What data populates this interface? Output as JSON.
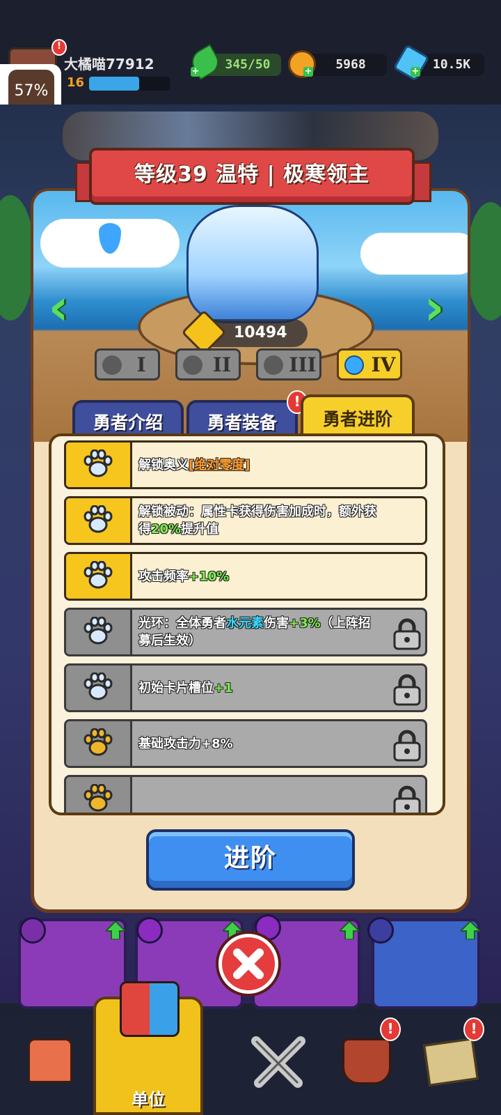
{
  "hud": {
    "player_name": "大橘喵77912",
    "level": "16",
    "xp_fraction": 0.62,
    "stamina": "345/50",
    "coins": "5968",
    "gems": "10.5K"
  },
  "overlay": {
    "percent": "57%"
  },
  "hero": {
    "title": "等级39 温特 | 极寒领主",
    "power": "10494",
    "ranks": [
      "I",
      "II",
      "III",
      "IV"
    ],
    "active_rank": "IV"
  },
  "tabs": [
    {
      "label": "勇者介绍",
      "active": false
    },
    {
      "label": "勇者装备",
      "active": false,
      "badge": "!"
    },
    {
      "label": "勇者进阶",
      "active": true
    }
  ],
  "advancement": [
    {
      "state": "unlocked",
      "paw": "blue",
      "parts": [
        "解锁奥义",
        "[绝对零度]"
      ]
    },
    {
      "state": "unlocked",
      "paw": "blue",
      "parts": [
        "解锁被动：属性卡获得伤害加成时，额外获得",
        "20%",
        "提升值"
      ]
    },
    {
      "state": "unlocked",
      "paw": "blue",
      "parts": [
        "攻击频率",
        "+10%"
      ]
    },
    {
      "state": "locked",
      "paw": "blue",
      "parts": [
        "光环：全体勇者",
        "水元素",
        "伤害",
        "+3%",
        "（上阵招募后生效）"
      ]
    },
    {
      "state": "locked",
      "paw": "blue",
      "parts": [
        "初始卡片槽位",
        "+1"
      ]
    },
    {
      "state": "locked",
      "paw": "gold",
      "parts": [
        "基础攻击力+8%"
      ]
    },
    {
      "state": "locked",
      "paw": "gold",
      "parts": [
        ""
      ]
    }
  ],
  "advance_button": "进阶",
  "bottom_nav": {
    "active_label": "单位"
  },
  "colors": {
    "accent_yellow": "#f6cf2b",
    "button_blue": "#3f8ff0",
    "banner_red": "#e04848",
    "highlight_green": "#7cf04c",
    "highlight_cyan": "#38d8ff",
    "highlight_orange": "#ff9a2a"
  }
}
